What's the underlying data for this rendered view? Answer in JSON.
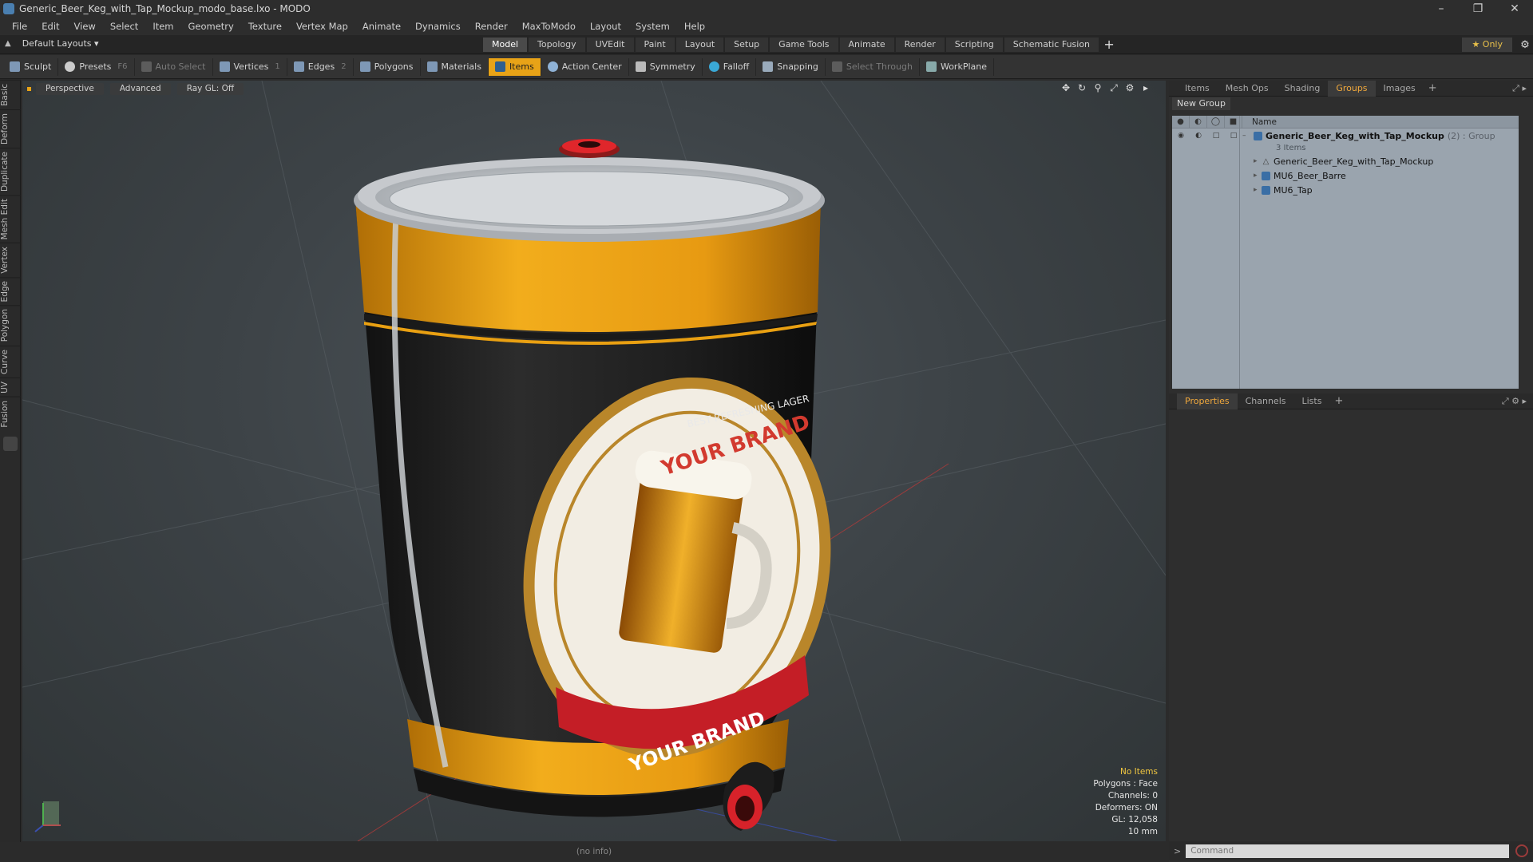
{
  "window": {
    "title": "Generic_Beer_Keg_with_Tap_Mockup_modo_base.lxo - MODO"
  },
  "menu": [
    "File",
    "Edit",
    "View",
    "Select",
    "Item",
    "Geometry",
    "Texture",
    "Vertex Map",
    "Animate",
    "Dynamics",
    "Render",
    "MaxToModo",
    "Layout",
    "System",
    "Help"
  ],
  "layoutbar": {
    "layout_label": "Default Layouts ▾",
    "tabs": [
      "Model",
      "Topology",
      "UVEdit",
      "Paint",
      "Layout",
      "Setup",
      "Game Tools",
      "Animate",
      "Render",
      "Scripting",
      "Schematic Fusion"
    ],
    "active_tab": "Model",
    "only_label": "★  Only"
  },
  "toolbar": {
    "sculpt": "Sculpt",
    "presets": "Presets",
    "presets_key": "F6",
    "auto_select": "Auto Select",
    "vertices": "Vertices",
    "vertices_count": "1",
    "edges": "Edges",
    "edges_count": "2",
    "polygons": "Polygons",
    "materials": "Materials",
    "items": "Items",
    "action_center": "Action Center",
    "symmetry": "Symmetry",
    "falloff": "Falloff",
    "snapping": "Snapping",
    "select_through": "Select Through",
    "workplane": "WorkPlane"
  },
  "left_tabs": [
    "Basic",
    "Deform",
    "Duplicate",
    "Mesh Edit",
    "Vertex",
    "Edge",
    "Polygon",
    "Curve",
    "UV",
    "Fusion"
  ],
  "viewport": {
    "view": "Perspective",
    "shading": "Advanced",
    "raygl": "Ray GL: Off",
    "label_brand_top": "YOUR BRAND",
    "label_brand_bottom": "YOUR BRAND",
    "label_tagline": "BEST REFRESHING LAGER",
    "stats": {
      "selection": "No Items",
      "polygons": "Polygons : Face",
      "channels": "Channels: 0",
      "deformers": "Deformers: ON",
      "gl": "GL: 12,058",
      "units": "10 mm"
    },
    "info": "(no info)"
  },
  "colors": {
    "accent": "#e8a317",
    "keg_orange": "#e9a012",
    "keg_black": "#1c1c1c",
    "outliner_bg": "#9aa4ae"
  },
  "right_panel": {
    "top_tabs": [
      "Items",
      "Mesh Ops",
      "Shading",
      "Groups",
      "Images"
    ],
    "active_top_tab": "Groups",
    "new_group": "New Group",
    "outliner_header": "Name",
    "group_name": "Generic_Beer_Keg_with_Tap_Mockup",
    "group_meta": "(2) : Group",
    "group_count": "3 Items",
    "items": [
      "Generic_Beer_Keg_with_Tap_Mockup",
      "MU6_Beer_Barre",
      "MU6_Tap"
    ],
    "bottom_tabs": [
      "Properties",
      "Channels",
      "Lists"
    ],
    "active_bottom_tab": "Properties",
    "command_placeholder": "Command"
  }
}
